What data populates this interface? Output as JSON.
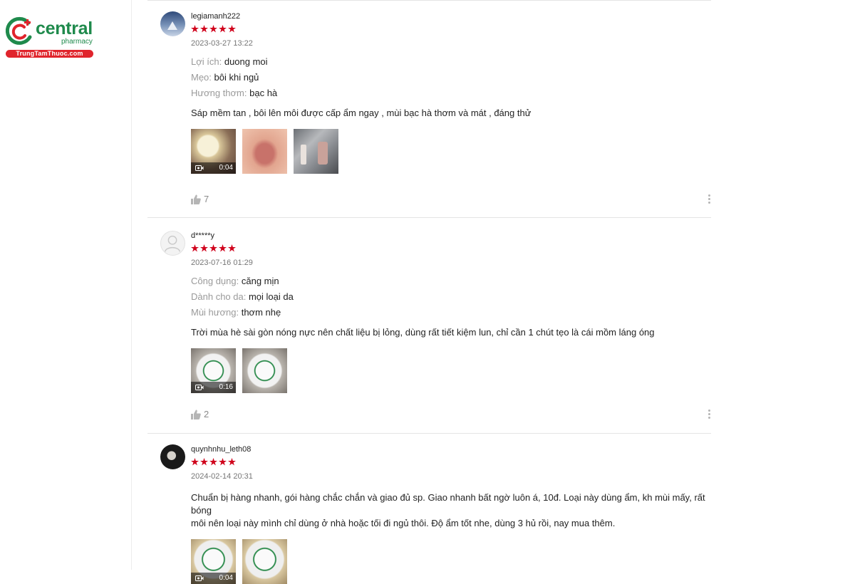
{
  "brand": {
    "name": "central",
    "sub": "pharmacy",
    "tagline": "TrungTamThuoc.com",
    "colors": {
      "green": "#1f8a4c",
      "red": "#e0242c"
    }
  },
  "star_color": "#d0011b",
  "reviews": [
    {
      "username": "legiamanh222",
      "rating": 5,
      "date": "2023-03-27 13:22",
      "attributes": [
        {
          "key": "Lợi ích:",
          "value": "duong moi"
        },
        {
          "key": "Mẹo:",
          "value": "bôi khi ngủ"
        },
        {
          "key": "Hương thơm:",
          "value": "bạc hà"
        }
      ],
      "comment": "Sáp mềm tan , bôi lên môi được cấp ẩm ngay , mùi bạc hà thơm và mát , đáng thử",
      "media": [
        {
          "type": "video",
          "duration": "0:04"
        },
        {
          "type": "image"
        },
        {
          "type": "image"
        }
      ],
      "likes": "7"
    },
    {
      "username": "d*****y",
      "rating": 5,
      "date": "2023-07-16 01:29",
      "attributes": [
        {
          "key": "Công dụng:",
          "value": "căng mịn"
        },
        {
          "key": "Dành cho da:",
          "value": "mọi loại da"
        },
        {
          "key": "Mùi hương:",
          "value": "thơm nhẹ"
        }
      ],
      "comment": "Trời mùa hè sài gòn nóng nực nên chất liệu bị lỏng, dùng rất tiết kiệm lun, chỉ cần 1 chút tẹo là cái mồm láng óng",
      "media": [
        {
          "type": "video",
          "duration": "0:16"
        },
        {
          "type": "image"
        }
      ],
      "likes": "2"
    },
    {
      "username": "quynhnhu_leth08",
      "rating": 5,
      "date": "2024-02-14 20:31",
      "comment_lines": [
        "Chuẩn bị hàng nhanh, gói hàng chắc chắn và giao đủ sp. Giao nhanh bất ngờ luôn á, 10đ. Loại này dùng ẩm, kh mùi mấy, rất bóng",
        "môi nên loại này mình chỉ dùng ở nhà hoặc tối đi ngủ thôi. Độ ẩm tốt nhe, dùng 3 hủ rồi, nay mua thêm."
      ],
      "media": [
        {
          "type": "video",
          "duration": "0:04"
        },
        {
          "type": "image"
        }
      ]
    }
  ]
}
